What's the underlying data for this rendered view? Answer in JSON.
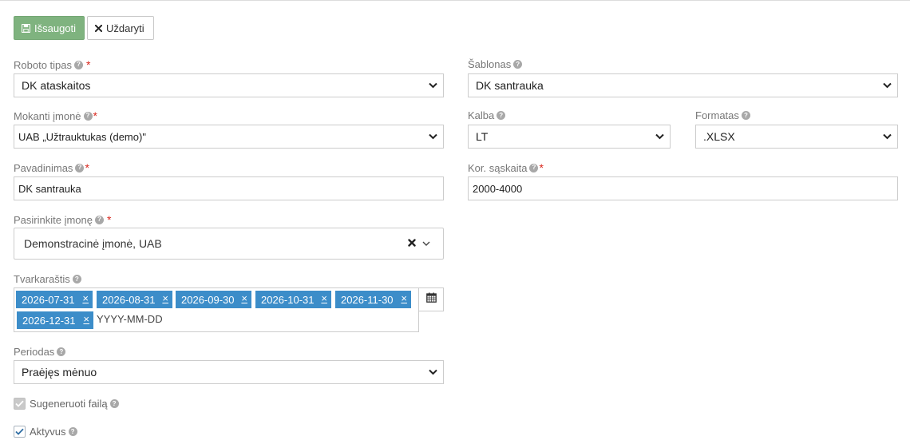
{
  "toolbar": {
    "save_label": "Išsaugoti",
    "close_label": "Uždaryti"
  },
  "form": {
    "robot_type": {
      "label": "Roboto tipas",
      "value": "DK ataskaitos"
    },
    "template": {
      "label": "Šablonas",
      "value": "DK santrauka"
    },
    "paying_company": {
      "label": "Mokanti įmonė",
      "value": "UAB „Užtrauktukas (demo)\""
    },
    "language": {
      "label": "Kalba",
      "value": "LT"
    },
    "format": {
      "label": "Formatas",
      "value": ".XLSX"
    },
    "name": {
      "label": "Pavadinimas",
      "value": "DK santrauka"
    },
    "corr_account": {
      "label": "Kor. sąskaita",
      "value": "2000-4000"
    },
    "choose_company": {
      "label": "Pasirinkite įmonę",
      "value": "Demonstracinė įmonė, UAB"
    },
    "schedule": {
      "label": "Tvarkaraštis",
      "dates": [
        "2026-07-31",
        "2026-08-31",
        "2026-09-30",
        "2026-10-31",
        "2026-11-30",
        "2026-12-31"
      ],
      "remove_glyph": "×",
      "placeholder": "YYYY-MM-DD"
    },
    "period": {
      "label": "Periodas",
      "value": "Praėjęs mėnuo"
    },
    "generate_file": {
      "label": "Sugeneruoti failą",
      "checked": true,
      "disabled": true
    },
    "active": {
      "label": "Aktyvus",
      "checked": true
    }
  },
  "icons": {
    "help": "?",
    "save": "floppy-disk-icon",
    "close": "times-icon",
    "calendar": "calendar-icon"
  },
  "colors": {
    "save_button": "#7fb37f",
    "tag": "#3c8dc9",
    "required": "#d9261c"
  }
}
